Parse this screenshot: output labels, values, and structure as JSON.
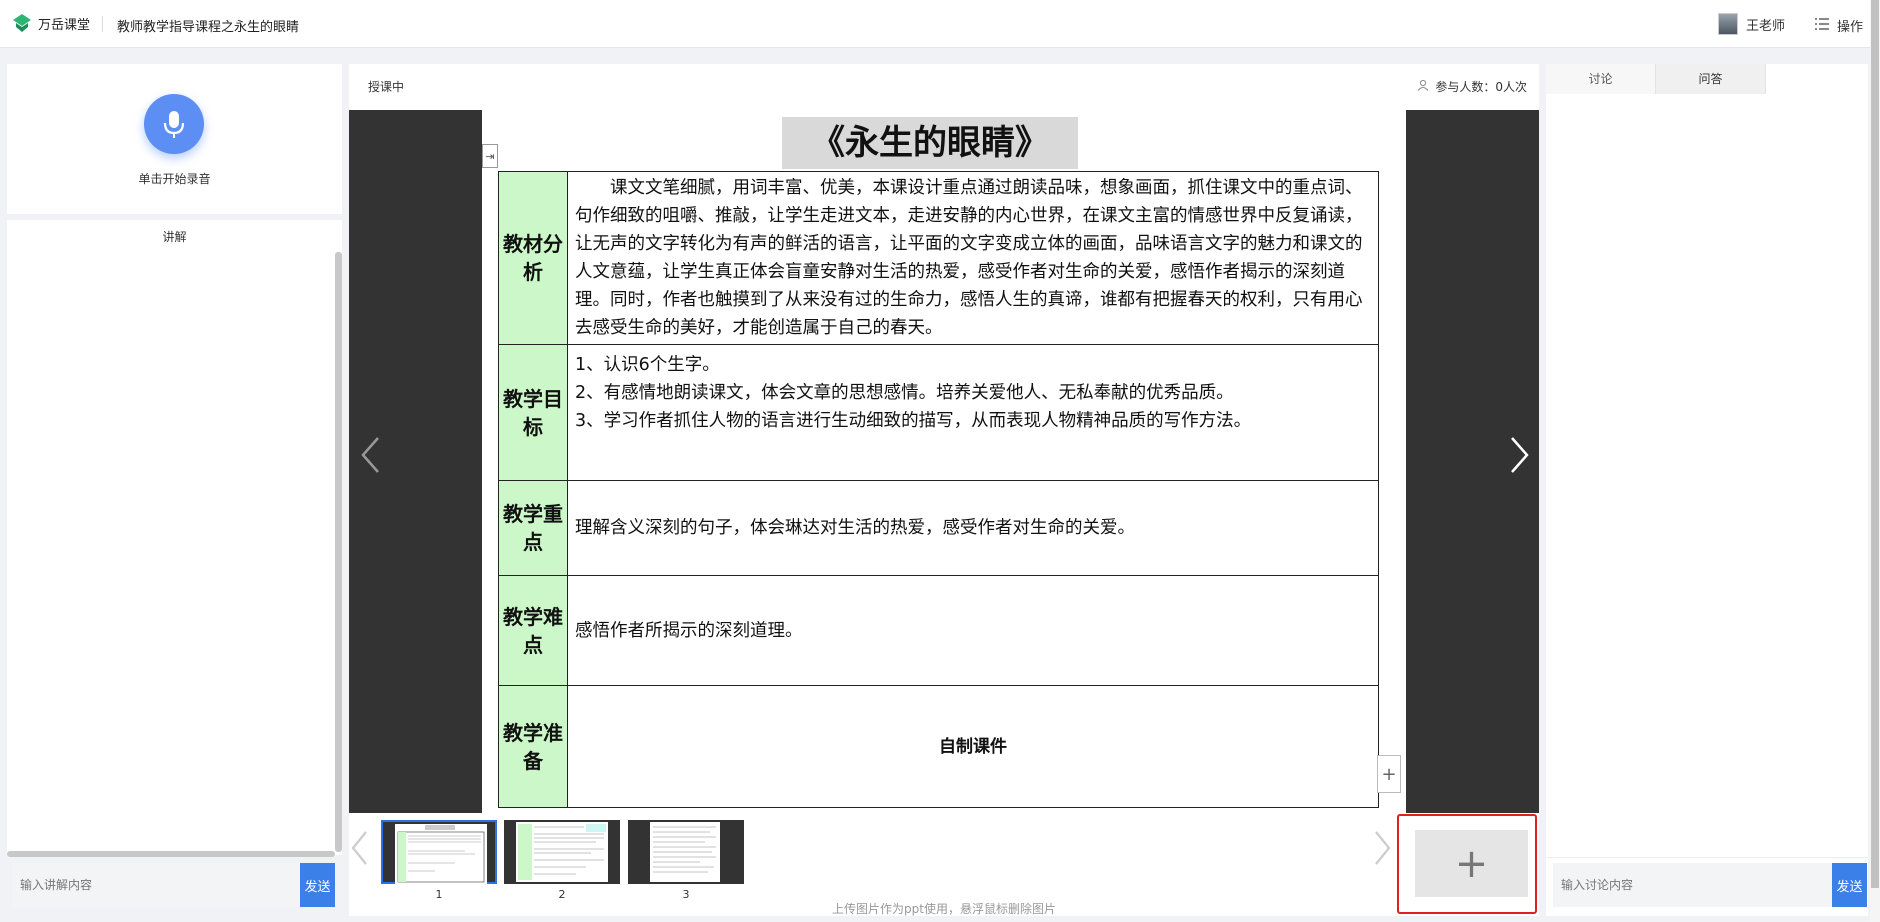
{
  "header": {
    "brand": "万岳课堂",
    "course_title": "教师教学指导课程之永生的眼睛",
    "user_name": "王老师",
    "ops_label": "操作"
  },
  "left": {
    "record_label": "单击开始录音",
    "explain_title": "讲解",
    "explain_placeholder": "输入讲解内容",
    "send_label": "发送"
  },
  "center": {
    "status": "授课中",
    "participants": "参与人数：0人次",
    "upload_hint": "上传图片作为ppt使用，悬浮鼠标删除图片",
    "add_symbol": "+",
    "thumbnails": [
      {
        "num": "1",
        "active": true
      },
      {
        "num": "2",
        "active": false
      },
      {
        "num": "3",
        "active": false
      }
    ]
  },
  "slide": {
    "title": "《永生的眼睛》",
    "rows": [
      {
        "label": "教材分析",
        "text": "　　课文文笔细腻，用词丰富、优美，本课设计重点通过朗读品味，想象画面，抓住课文中的重点词、句作细致的咀嚼、推敲，让学生走进文本，走进安静的内心世界，在课文主富的情感世界中反复诵读，让无声的文字转化为有声的鲜活的语言，让平面的文字变成立体的画面，品味语言文字的魅力和课文的人文意蕴，让学生真正体会盲童安静对生活的热爱，感受作者对生命的关爱，感悟作者揭示的深刻道理。同时，作者也触摸到了从来没有过的生命力，感悟人生的真谛，谁都有把握春天的权利，只有用心去感受生命的美好，才能创造属于自己的春天。"
      },
      {
        "label": "教学目标",
        "line1": " 1、认识6个生字。",
        "line2": "2、有感情地朗读课文，体会文章的思想感情。培养关爱他人、无私奉献的优秀品质。",
        "line3": "3、学习作者抓住人物的语言进行生动细致的描写，从而表现人物精神品质的写作方法。"
      },
      {
        "label": "教学重点",
        "text": "理解含义深刻的句子，体会琳达对生活的热爱，感受作者对生命的关爱。"
      },
      {
        "label": "教学难点",
        "text": "感悟作者所揭示的深刻道理。"
      },
      {
        "label": "教学准备",
        "text": "自制课件"
      }
    ]
  },
  "right": {
    "tab_discussion": "讨论",
    "tab_qa": "问答",
    "discussion_placeholder": "输入讨论内容",
    "send_label": "发送"
  }
}
